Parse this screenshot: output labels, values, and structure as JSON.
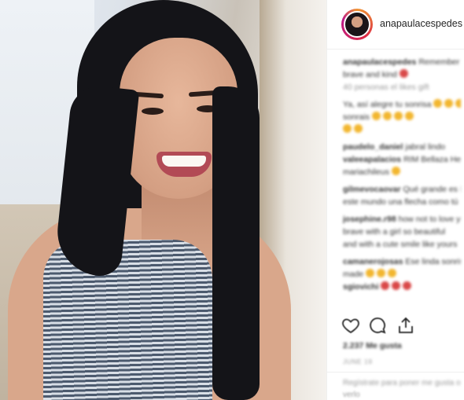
{
  "post": {
    "username": "anapaulacespedes"
  },
  "comments": [
    {
      "user": "anapaulacespedes",
      "text": "Remember to always have a brave and kind"
    },
    {
      "user": "",
      "text": "40 personas el likes gift"
    },
    {
      "user": "",
      "text": "Ya, así alegre tu sonrisa"
    },
    {
      "user": "",
      "text": "sonrais"
    },
    {
      "user": "",
      "text": ""
    },
    {
      "user": "paudelo_daniel",
      "text": "jabral lindo"
    },
    {
      "user": "valeeapalacios",
      "text": "RIM Bellaza Hermosa"
    },
    {
      "user": "",
      "text": "mariachileus"
    },
    {
      "user": "gilmevocaovar",
      "text": "Qué grande es Dios que"
    },
    {
      "user": "",
      "text": "este mundo una flecha como tú"
    },
    {
      "user": "josephine.r98",
      "text": "how not to love you are"
    },
    {
      "user": "",
      "text": "brave with a girl so beautiful"
    },
    {
      "user": "",
      "text": "and with a cute smile like yours"
    },
    {
      "user": "camanerojosas",
      "text": "Ese linda sonrisa"
    },
    {
      "user": "",
      "text": "made"
    },
    {
      "user": "sgiovichi",
      "text": ""
    }
  ],
  "footer": {
    "likes": "2.237 Me gusta",
    "time": "JUNE 19",
    "add_comment": "Regístrate para poner me gusta o",
    "add_comment2": "verlo"
  },
  "colors": {
    "text": "#262626",
    "muted": "#999999",
    "ring_gradient": [
      "#f09433",
      "#dc2743",
      "#bc1888"
    ]
  },
  "icons": {
    "like": "heart-icon",
    "comment": "comment-icon",
    "share": "share-icon"
  }
}
